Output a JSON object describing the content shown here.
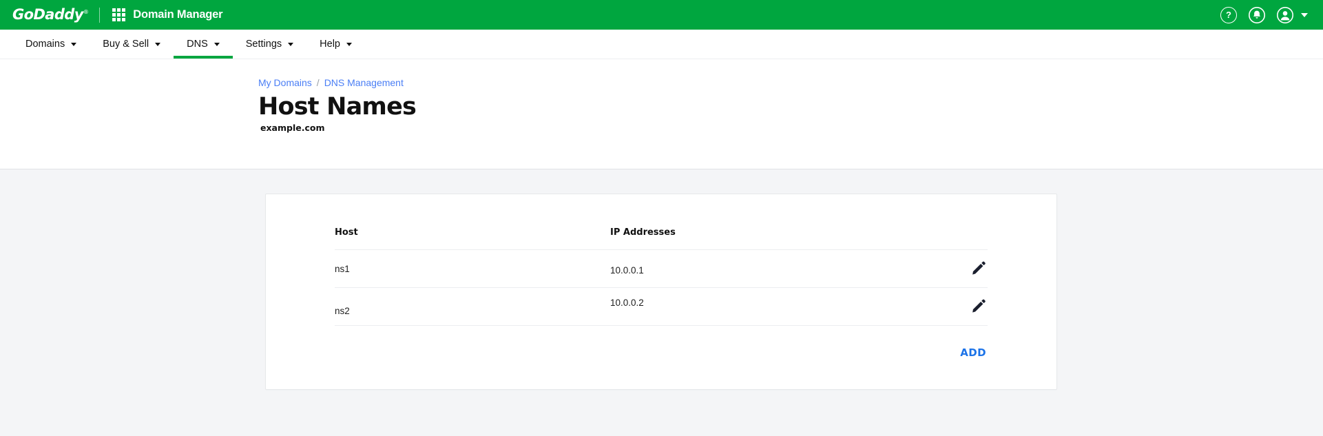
{
  "brand": {
    "logo_text": "GoDaddy",
    "logo_tm": "®",
    "app_title": "Domain Manager",
    "grid_icon_name": "app-grid-icon",
    "help_icon_label": "?",
    "icons": [
      "help-icon",
      "notifications-bell-icon",
      "user-avatar-icon",
      "account-chevron-down-icon"
    ],
    "accent_green": "#00a63f"
  },
  "nav": {
    "items": [
      {
        "label": "Domains",
        "active": false
      },
      {
        "label": "Buy & Sell",
        "active": false
      },
      {
        "label": "DNS",
        "active": true
      },
      {
        "label": "Settings",
        "active": false
      },
      {
        "label": "Help",
        "active": false
      }
    ]
  },
  "breadcrumb": {
    "items": [
      "My Domains",
      "DNS Management"
    ],
    "separator": "/",
    "link_color": "#4a7ef5"
  },
  "page": {
    "title": "Host Names",
    "subtitle": "example.com"
  },
  "table": {
    "columns": [
      "Host",
      "IP Addresses",
      ""
    ],
    "rows": [
      {
        "host": "ns1",
        "ip": "10.0.0.1",
        "edit_icon": "pencil-edit-icon"
      },
      {
        "host": "ns2",
        "ip": "10.0.0.2",
        "edit_icon": "pencil-edit-icon"
      }
    ]
  },
  "footer": {
    "add_label": "ADD",
    "add_color": "#1c73e8"
  }
}
